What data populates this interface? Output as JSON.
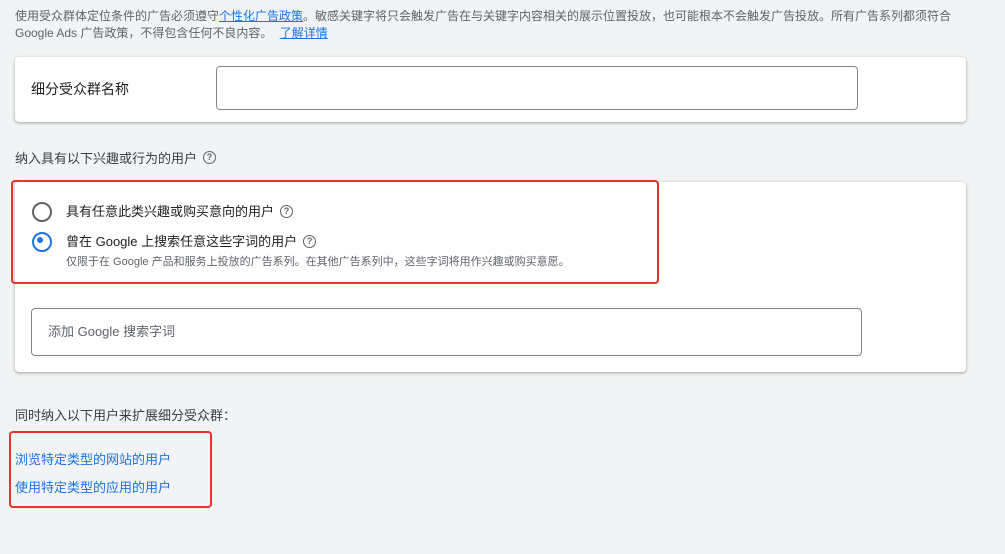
{
  "notice": {
    "text_before": "使用受众群体定位条件的广告必须遵守",
    "policy_link": "个性化广告政策",
    "text_after": "。敏感关键字将只会触发广告在与关键字内容相关的展示位置投放，也可能根本不会触发广告投放。所有广告系列都须符合 Google Ads 广告政策，不得包含任何不良内容。",
    "learn_more": "了解详情"
  },
  "segment_name": {
    "label": "细分受众群名称",
    "value": ""
  },
  "interest_section": {
    "title": "纳入具有以下兴趣或行为的用户",
    "options": [
      {
        "label": "具有任意此类兴趣或购买意向的用户",
        "checked": false,
        "sub": ""
      },
      {
        "label": "曾在 Google 上搜索任意这些字词的用户",
        "checked": true,
        "sub": "仅限于在 Google 产品和服务上投放的广告系列。在其他广告系列中，这些字词将用作兴趣或购买意愿。"
      }
    ],
    "search_placeholder": "添加 Google 搜索字词"
  },
  "expand_section": {
    "title": "同时纳入以下用户来扩展细分受众群：",
    "links": [
      "浏览特定类型的网站的用户",
      "使用特定类型的应用的用户"
    ]
  },
  "colors": {
    "accent": "#1a73e8",
    "highlight": "#e8322d"
  }
}
